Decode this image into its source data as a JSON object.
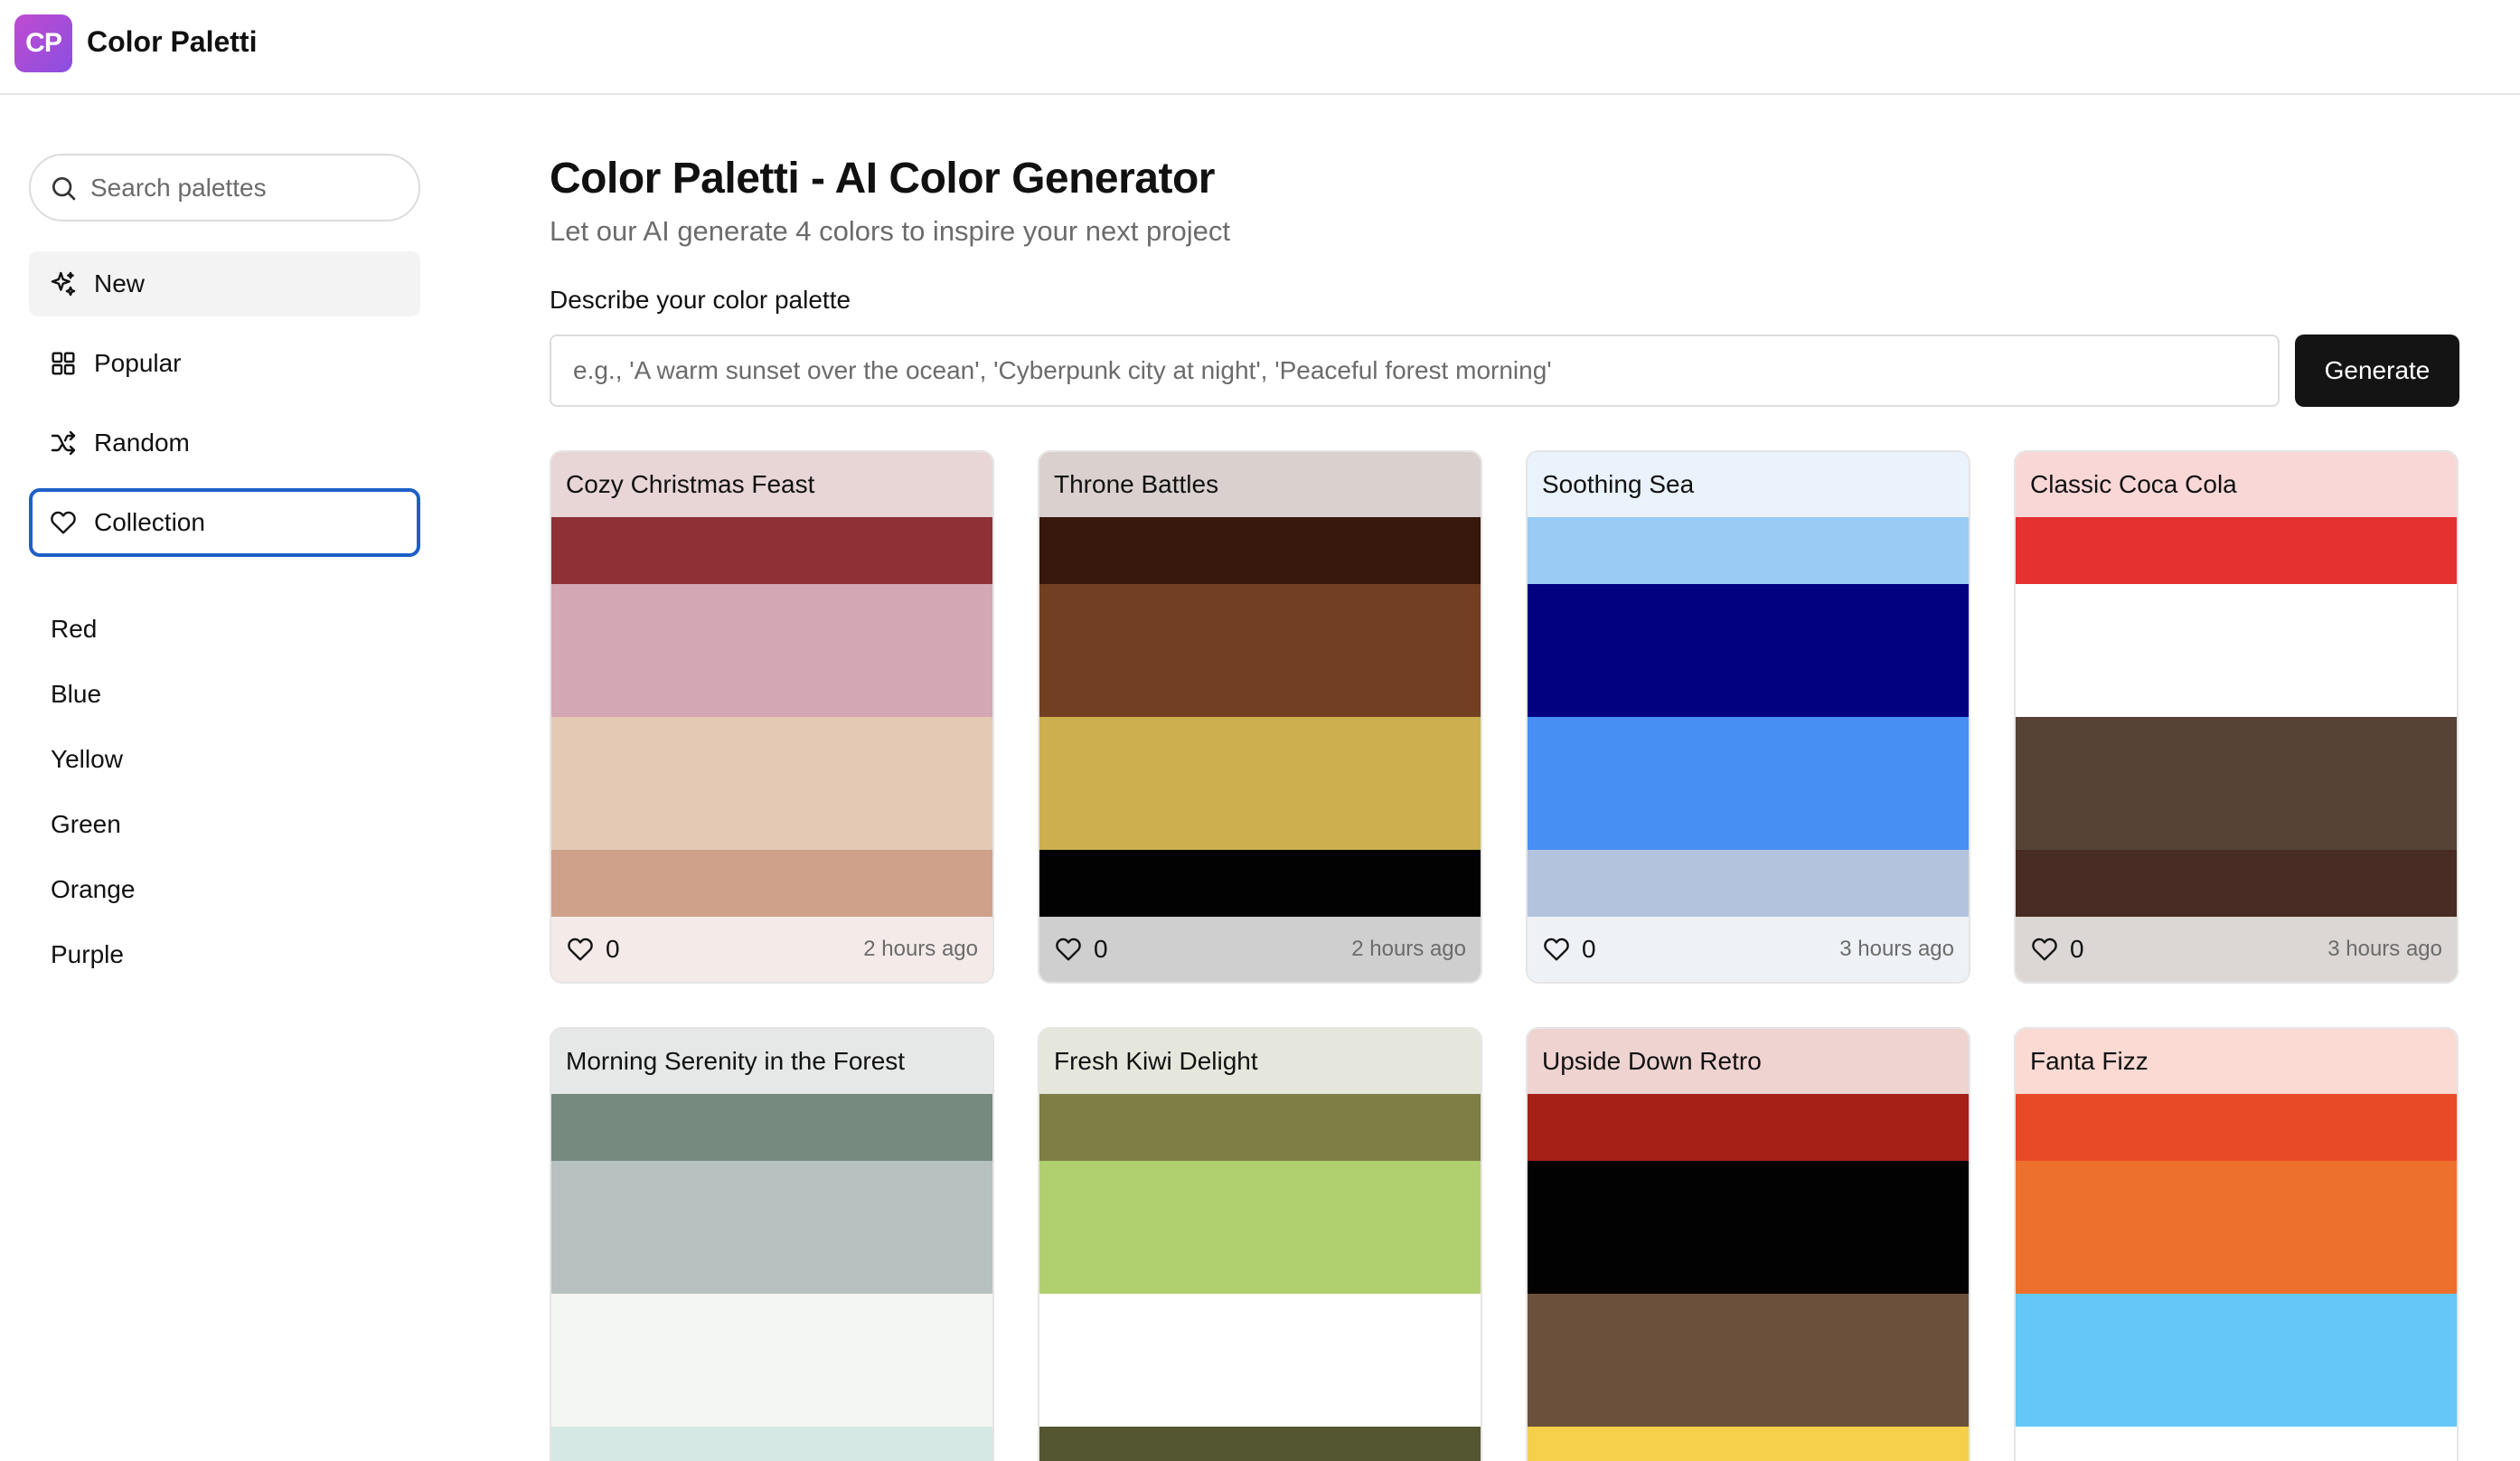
{
  "app": {
    "logo_text": "CP",
    "name": "Color Paletti"
  },
  "sidebar": {
    "search_placeholder": "Search palettes",
    "nav": [
      {
        "label": "New",
        "icon": "sparkles-icon"
      },
      {
        "label": "Popular",
        "icon": "grid-icon"
      },
      {
        "label": "Random",
        "icon": "shuffle-icon"
      },
      {
        "label": "Collection",
        "icon": "heart-icon"
      }
    ],
    "colors": [
      "Red",
      "Blue",
      "Yellow",
      "Green",
      "Orange",
      "Purple"
    ]
  },
  "main": {
    "title": "Color Paletti - AI Color Generator",
    "subtitle": "Let our AI generate 4 colors to inspire your next project",
    "field_label": "Describe your color palette",
    "input_placeholder": "e.g., 'A warm sunset over the ocean', 'Cyberpunk city at night', 'Peaceful forest morning'",
    "generate_label": "Generate"
  },
  "palettes": [
    {
      "name": "Cozy Christmas Feast",
      "likes": "0",
      "time": "2 hours ago",
      "header_bg": "#e8d6d6",
      "footer_bg": "#f4ebe8",
      "colors": [
        "#8e3036",
        "#d3a7b3",
        "#e4cab5",
        "#cfa18a"
      ]
    },
    {
      "name": "Throne Battles",
      "likes": "0",
      "time": "2 hours ago",
      "header_bg": "#dad1cf",
      "footer_bg": "#cfcfcf",
      "colors": [
        "#38170c",
        "#733f22",
        "#ccb04f",
        "#020202"
      ]
    },
    {
      "name": "Soothing Sea",
      "likes": "0",
      "time": "3 hours ago",
      "header_bg": "#eaf3fc",
      "footer_bg": "#eef2f7",
      "colors": [
        "#99cbf5",
        "#020280",
        "#478ff3",
        "#b3c3de"
      ]
    },
    {
      "name": "Classic Coca Cola",
      "likes": "0",
      "time": "3 hours ago",
      "header_bg": "#fad7d7",
      "footer_bg": "#dcd7d4",
      "colors": [
        "#e5312f",
        "#ffffff",
        "#564335",
        "#482b22"
      ]
    },
    {
      "name": "Morning Serenity in the Forest",
      "likes": "",
      "time": "",
      "header_bg": "#e6e8e7",
      "footer_bg": "#ffffff",
      "colors": [
        "#768a80",
        "#b7c2c0",
        "#f4f6f4",
        "#d6e8e4"
      ]
    },
    {
      "name": "Fresh Kiwi Delight",
      "likes": "",
      "time": "",
      "header_bg": "#e6e7dc",
      "footer_bg": "#ffffff",
      "colors": [
        "#7e7e45",
        "#b0d070",
        "#ffffff",
        "#535631"
      ]
    },
    {
      "name": "Upside Down Retro",
      "likes": "",
      "time": "",
      "header_bg": "#eed3d1",
      "footer_bg": "#ffffff",
      "colors": [
        "#a52117",
        "#020202",
        "#6b513b",
        "#f6d04b"
      ]
    },
    {
      "name": "Fanta Fizz",
      "likes": "",
      "time": "",
      "header_bg": "#fbdad3",
      "footer_bg": "#ffffff",
      "colors": [
        "#e84a27",
        "#ed712c",
        "#65c7f6",
        "#ffffff"
      ]
    }
  ]
}
